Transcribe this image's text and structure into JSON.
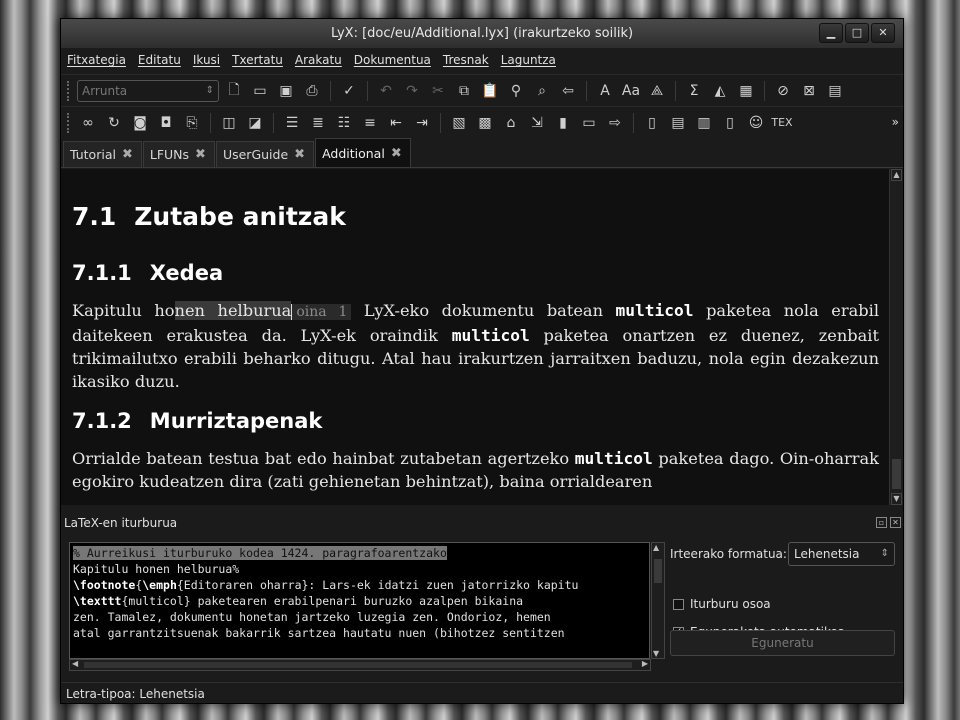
{
  "window": {
    "title": "LyX: [doc/eu/Additional.lyx] (irakurtzeko soilik)",
    "buttons": [
      "minimize",
      "maximize",
      "close"
    ]
  },
  "menu": [
    "Fitxategia",
    "Editatu",
    "Ikusi",
    "Txertatu",
    "Arakatu",
    "Dokumentua",
    "Tresnak",
    "Laguntza"
  ],
  "toolbar1": {
    "paragraph_style": "Arrunta",
    "icons": [
      "new-document-icon",
      "open-icon",
      "save-icon",
      "print-icon",
      "spellcheck-icon",
      "undo-icon",
      "redo-icon",
      "cut-icon",
      "copy-icon",
      "paste-icon",
      "find-icon",
      "zoom-icon",
      "insert-icon",
      "emphasis-icon",
      "noun-icon",
      "style-icon",
      "math-icon",
      "figure-icon",
      "table-icon",
      "navigate-icon",
      "view-source-icon",
      "table-grid-icon"
    ]
  },
  "toolbar2": {
    "icons": [
      "view-icon",
      "update-icon",
      "view-dvi-icon",
      "view-pdf-icon",
      "view-ps-icon",
      "track-changes-icon",
      "review-icon",
      "list-icon",
      "enumerate-icon",
      "itemize-icon",
      "description-icon",
      "depth-decrease-icon",
      "depth-increase-icon",
      "float-icon",
      "table-insert-icon",
      "label-icon",
      "cross-ref-icon",
      "note-icon",
      "footnote-icon",
      "index-icon",
      "hyperlink-icon",
      "document-icon",
      "page-icon",
      "text-icon",
      "box-icon",
      "math-face-icon",
      "tex-icon"
    ],
    "more": "»"
  },
  "tabs": [
    {
      "label": "Tutorial"
    },
    {
      "label": "LFUNs"
    },
    {
      "label": "UserGuide"
    },
    {
      "label": "Additional"
    }
  ],
  "document": {
    "section_number": "7.1",
    "section_title": "Zutabe anitzak",
    "sub1_number": "7.1.1",
    "sub1_title": "Xedea",
    "para1_a": "Kapitulu ho",
    "para1_hl": "nen helburua",
    "para1_inset": "oina 1",
    "para1_b": " LyX-eko dokumentu batean ",
    "para1_mono1": "multicol",
    "para1_c": " paketea nola erabil daitekeen erakustea da. LyX-ek oraindik ",
    "para1_mono2": "multicol",
    "para1_d": " paketea onartzen ez duenez, zenbait trikimailutxo erabili beharko ditugu. Atal hau irakurtzen jarraitxen baduzu, nola egin dezakezun ikasiko duzu.",
    "sub2_number": "7.1.2",
    "sub2_title": "Murriztapenak",
    "para2_a": "Orrialde batean testua bat edo hainbat zutabetan agertzeko ",
    "para2_mono": "multicol",
    "para2_b": " paketea dago. Oin-oharrak egokiro kudeatzen dira (zati gehienetan behintzat), baina orrialdearen"
  },
  "source_panel": {
    "title": "LaTeX-en iturburua",
    "line1": "% Aurreikusi iturburuko kodea 1424. paragrafoarentzako",
    "line2": "",
    "line3": "Kapitulu honen helburua%",
    "line4_cmd1": "\\footnote",
    "line4_a": "{",
    "line4_cmd2": "\\emph",
    "line4_b": "{Editoraren oharra}: Lars-ek idatzi zuen jatorrizko kapitu",
    "line5_cmd": "\\texttt",
    "line5_b": "{multicol} paketearen erabilpenari buruzko azalpen bikaina",
    "line6": "zen. Tamalez, dokumentu honetan jartzeko luzegia zen. Ondorioz, hemen",
    "line7": "atal garrantzitsuenak bakarrik sartzea hautatu nuen (bihotzez sentitzen",
    "output_format_label": "Irteerako formatua:",
    "output_format_value": "Lehenetsia",
    "full_source_label": "Iturburu osoa",
    "full_source_checked": false,
    "auto_update_label": "Eguneraketa automatikoa",
    "auto_update_checked": true,
    "update_button": "Eguneratu"
  },
  "status": "Letra-tipoa: Lehenetsia"
}
